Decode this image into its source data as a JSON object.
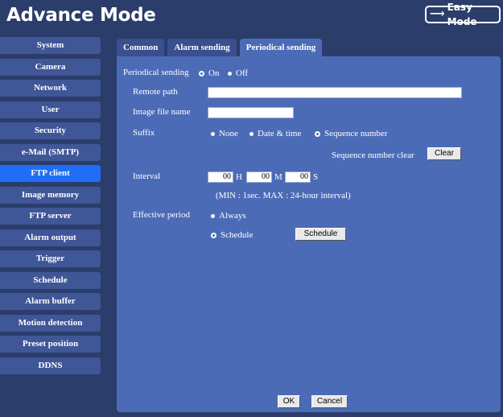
{
  "header": {
    "title": "Advance Mode",
    "easy_mode_label": "Easy Mode"
  },
  "sidebar": {
    "items": [
      {
        "label": "System"
      },
      {
        "label": "Camera"
      },
      {
        "label": "Network"
      },
      {
        "label": "User"
      },
      {
        "label": "Security"
      },
      {
        "label": "e-Mail (SMTP)"
      },
      {
        "label": "FTP client",
        "active": true
      },
      {
        "label": "Image memory"
      },
      {
        "label": "FTP server"
      },
      {
        "label": "Alarm output"
      },
      {
        "label": "Trigger"
      },
      {
        "label": "Schedule"
      },
      {
        "label": "Alarm buffer"
      },
      {
        "label": "Motion detection"
      },
      {
        "label": "Preset position"
      },
      {
        "label": "DDNS"
      }
    ]
  },
  "tabs": [
    {
      "label": "Common"
    },
    {
      "label": "Alarm sending"
    },
    {
      "label": "Periodical sending",
      "active": true
    }
  ],
  "form": {
    "periodical_sending": {
      "label": "Periodical sending",
      "on": "On",
      "off": "Off",
      "selected": "On"
    },
    "remote_path": {
      "label": "Remote path",
      "value": ""
    },
    "image_file_name": {
      "label": "Image file name",
      "value": ""
    },
    "suffix": {
      "label": "Suffix",
      "none": "None",
      "date_time": "Date & time",
      "sequence": "Sequence number",
      "selected": "Sequence number"
    },
    "sequence_clear": {
      "label": "Sequence number clear",
      "button": "Clear"
    },
    "interval": {
      "label": "Interval",
      "h_value": "00",
      "h_unit": "H",
      "m_value": "00",
      "m_unit": "M",
      "s_value": "00",
      "s_unit": "S",
      "note": "(MIN : 1sec. MAX : 24-hour interval)"
    },
    "effective_period": {
      "label": "Effective period",
      "always": "Always",
      "schedule": "Schedule",
      "selected": "Schedule",
      "schedule_button": "Schedule"
    }
  },
  "footer": {
    "ok": "OK",
    "cancel": "Cancel"
  },
  "colors": {
    "background": "#2b3d6b",
    "panel": "#4c6bb7",
    "sidebar_item": "#3f5697",
    "sidebar_active": "#1f6ef5"
  }
}
